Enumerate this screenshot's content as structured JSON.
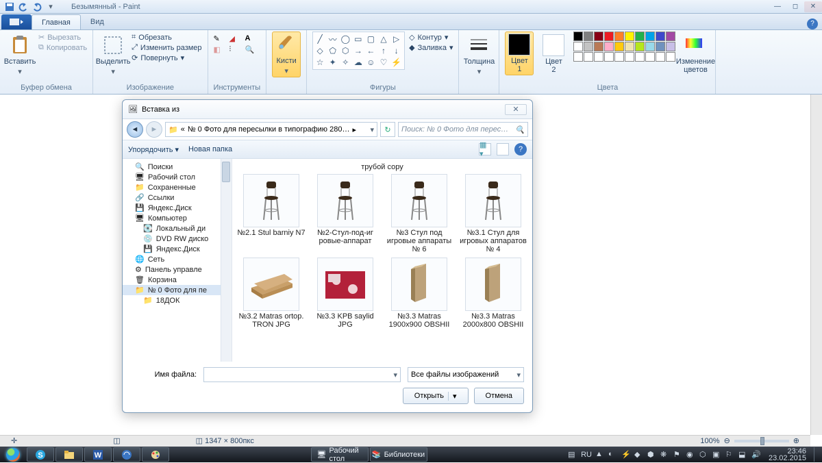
{
  "window": {
    "title": "Безымянный - Paint"
  },
  "tabs": {
    "file_icon": "file",
    "main": "Главная",
    "view": "Вид"
  },
  "ribbon": {
    "clipboard": {
      "paste": "Вставить",
      "cut": "Вырезать",
      "copy": "Копировать",
      "label": "Буфер обмена"
    },
    "image": {
      "select": "Выделить",
      "crop": "Обрезать",
      "resize": "Изменить размер",
      "rotate": "Повернуть",
      "label": "Изображение"
    },
    "tools": {
      "label": "Инструменты"
    },
    "brushes": {
      "label": "Кисти"
    },
    "shapes": {
      "outline": "Контур",
      "fill": "Заливка",
      "label": "Фигуры"
    },
    "thickness": {
      "label": "Толщина"
    },
    "color1": {
      "label": "Цвет\n1"
    },
    "color2": {
      "label": "Цвет\n2"
    },
    "colors": {
      "label": "Цвета",
      "edit": "Изменение\nцветов"
    },
    "palette": [
      "#000000",
      "#7f7f7f",
      "#880015",
      "#ed1c24",
      "#ff7f27",
      "#fff200",
      "#22b14c",
      "#00a2e8",
      "#3f48cc",
      "#a349a4",
      "#ffffff",
      "#c3c3c3",
      "#b97a57",
      "#ffaec9",
      "#ffc90e",
      "#efe4b0",
      "#b5e61d",
      "#99d9ea",
      "#7092be",
      "#c8bfe7",
      "#ffffff",
      "#ffffff",
      "#ffffff",
      "#ffffff",
      "#ffffff",
      "#ffffff",
      "#ffffff",
      "#ffffff",
      "#ffffff",
      "#ffffff"
    ]
  },
  "status": {
    "dims": "1347 × 800пкс",
    "zoom": "100%"
  },
  "dialog": {
    "title": "Вставка из",
    "path": "№ 0 Фото для пересылки в типографию 280…",
    "search_placeholder": "Поиск: № 0 Фото для перес…",
    "organize": "Упорядочить",
    "new_folder": "Новая папка",
    "remnant_caption": "трубой сору",
    "tree": [
      "Поиски",
      "Рабочий стол",
      "Сохраненные",
      "Ссылки",
      "Яндекс.Диск",
      "Компьютер",
      "Локальный ди",
      "DVD RW диско",
      "Яндекс.Диск",
      "Сеть",
      "Панель управле",
      "Корзина",
      "№ 0 Фото для пе",
      "18ДОК"
    ],
    "files": [
      {
        "c": "№2.1 Stul barniy N7",
        "t": "stool"
      },
      {
        "c": "№2-Стул-под-иг ровые-аппарат",
        "t": "stool"
      },
      {
        "c": "№3 Стул под игровые аппараты № 6",
        "t": "stool"
      },
      {
        "c": "№3.1 Стул для игровых аппаратов № 4",
        "t": "stool"
      },
      {
        "c": "№3.2 Matras ortop. TRON JPG",
        "t": "mattress"
      },
      {
        "c": "№3.3 KPB saylid JPG",
        "t": "bedding"
      },
      {
        "c": "№3.3 Matras 1900х900 OBSHII",
        "t": "mattress2"
      },
      {
        "c": "№3.3 Matras 2000х800 OBSHII",
        "t": "mattress2"
      }
    ],
    "filename_label": "Имя файла:",
    "filter": "Все файлы изображений",
    "open": "Открыть",
    "cancel": "Отмена"
  },
  "taskbar": {
    "desktop": "Рабочий стол",
    "libraries": "Библиотеки",
    "lang": "RU",
    "time": "23:46",
    "date": "23.02.2015"
  }
}
